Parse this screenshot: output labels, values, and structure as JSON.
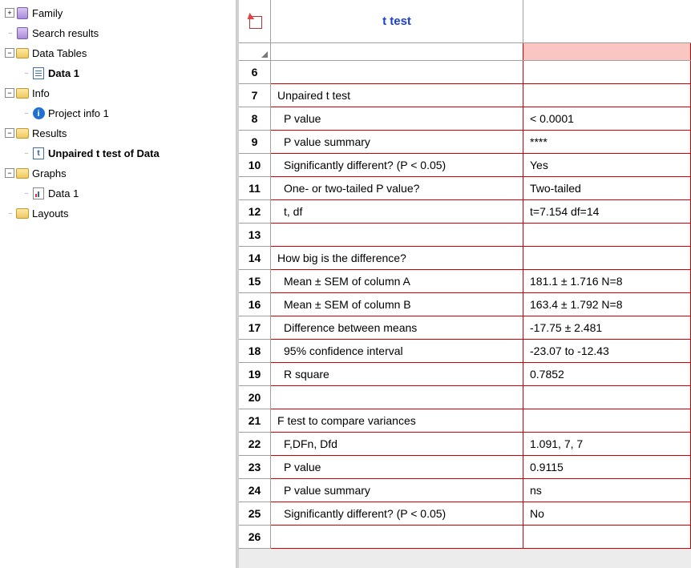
{
  "tree": {
    "family": "Family",
    "search": "Search results",
    "dataTables": "Data Tables",
    "data1": "Data 1",
    "info": "Info",
    "projectInfo": "Project info 1",
    "results": "Results",
    "unpairedT": "Unpaired t test of Data",
    "graphs": "Graphs",
    "graphsData1": "Data 1",
    "layouts": "Layouts"
  },
  "table": {
    "title": "t test",
    "rows": [
      {
        "n": "6",
        "desc": "",
        "val": "",
        "indent": false
      },
      {
        "n": "7",
        "desc": "Unpaired t test",
        "val": "",
        "indent": false
      },
      {
        "n": "8",
        "desc": "P value",
        "val": "< 0.0001",
        "indent": true
      },
      {
        "n": "9",
        "desc": "P value summary",
        "val": "****",
        "indent": true
      },
      {
        "n": "10",
        "desc": "Significantly different? (P < 0.05)",
        "val": "Yes",
        "indent": true
      },
      {
        "n": "11",
        "desc": "One- or two-tailed P value?",
        "val": "Two-tailed",
        "indent": true
      },
      {
        "n": "12",
        "desc": "t, df",
        "val": "t=7.154 df=14",
        "indent": true
      },
      {
        "n": "13",
        "desc": "",
        "val": "",
        "indent": false
      },
      {
        "n": "14",
        "desc": "How big is the difference?",
        "val": "",
        "indent": false
      },
      {
        "n": "15",
        "desc": "Mean ± SEM of column A",
        "val": "181.1 ± 1.716 N=8",
        "indent": true
      },
      {
        "n": "16",
        "desc": "Mean ± SEM of column B",
        "val": "163.4 ± 1.792 N=8",
        "indent": true
      },
      {
        "n": "17",
        "desc": "Difference between means",
        "val": "-17.75 ± 2.481",
        "indent": true
      },
      {
        "n": "18",
        "desc": "95% confidence interval",
        "val": "-23.07 to -12.43",
        "indent": true
      },
      {
        "n": "19",
        "desc": "R square",
        "val": "0.7852",
        "indent": true
      },
      {
        "n": "20",
        "desc": "",
        "val": "",
        "indent": false
      },
      {
        "n": "21",
        "desc": "F test to compare variances",
        "val": "",
        "indent": false
      },
      {
        "n": "22",
        "desc": "F,DFn, Dfd",
        "val": "1.091, 7, 7",
        "indent": true
      },
      {
        "n": "23",
        "desc": "P value",
        "val": "0.9115",
        "indent": true
      },
      {
        "n": "24",
        "desc": "P value summary",
        "val": "ns",
        "indent": true
      },
      {
        "n": "25",
        "desc": "Significantly different? (P < 0.05)",
        "val": "No",
        "indent": true
      },
      {
        "n": "26",
        "desc": "",
        "val": "",
        "indent": false
      }
    ]
  }
}
